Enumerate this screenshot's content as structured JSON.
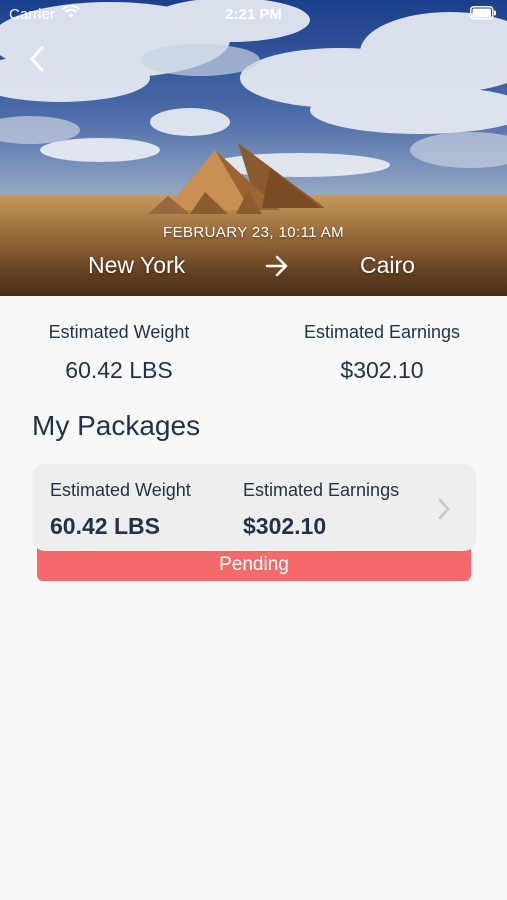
{
  "status_bar": {
    "carrier": "Carrier",
    "time": "2:21 PM"
  },
  "trip": {
    "date": "FEBRUARY 23, 10:11 AM",
    "origin": "New York",
    "destination": "Cairo",
    "hero_image": "pyramids-desert-photo"
  },
  "summary": {
    "weight_label": "Estimated Weight",
    "weight_value": "60.42 LBS",
    "earnings_label": "Estimated Earnings",
    "earnings_value": "$302.10"
  },
  "packages_section": {
    "title": "My Packages"
  },
  "packages": [
    {
      "weight_label": "Estimated Weight",
      "weight_value": "60.42 LBS",
      "earnings_label": "Estimated Earnings",
      "earnings_value": "$302.10",
      "status": "Pending"
    }
  ],
  "colors": {
    "text_primary": "#1f3247",
    "status_pending": "#f56a6a",
    "card_background": "#eeeeee",
    "page_background": "#f8f8f8"
  },
  "icons": [
    "wifi-icon",
    "battery-icon",
    "back-chevron-icon",
    "arrow-right-icon",
    "chevron-right-icon"
  ]
}
